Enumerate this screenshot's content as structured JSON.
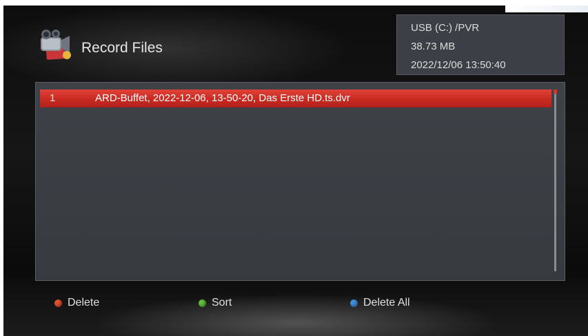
{
  "header": {
    "title": "Record Files",
    "icon": "video-camera-icon"
  },
  "info": {
    "device_path": "USB (C:) /PVR",
    "size": "38.73 MB",
    "datetime": "2022/12/06 13:50:40"
  },
  "files": [
    {
      "index": "1",
      "name": "ARD-Buffet, 2022-12-06, 13-50-20, Das Erste HD.ts.dvr",
      "selected": true
    }
  ],
  "footer": {
    "keys": [
      {
        "label": "Delete",
        "color": "#e4502f"
      },
      {
        "label": "Sort",
        "color": "#5fbf3a"
      },
      {
        "label": "Delete All",
        "color": "#3f8fd8"
      }
    ]
  },
  "colors": {
    "highlight": "#d0342b",
    "panel": "#3c4046",
    "background": "#111111"
  }
}
